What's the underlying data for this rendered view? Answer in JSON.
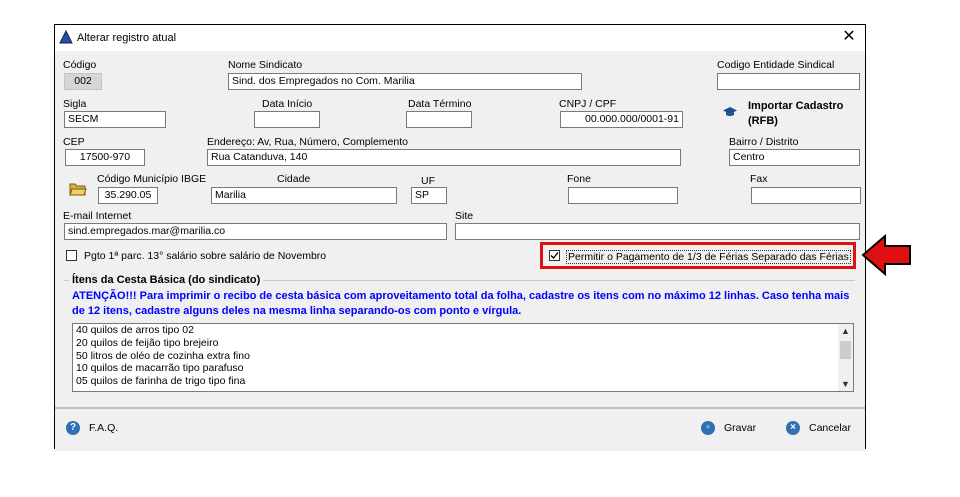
{
  "window": {
    "title": "Alterar registro atual",
    "close": "✕"
  },
  "fields": {
    "codigo": {
      "label": "Código",
      "value": "002"
    },
    "nome_sindicato": {
      "label": "Nome Sindicato",
      "value": "Sind. dos Empregados no Com. Marilia"
    },
    "codigo_entidade": {
      "label": "Codigo Entidade Sindical",
      "value": ""
    },
    "sigla": {
      "label": "Sigla",
      "value": "SECM"
    },
    "data_inicio": {
      "label": "Data Início",
      "value": ""
    },
    "data_termino": {
      "label": "Data Término",
      "value": ""
    },
    "cnpj": {
      "label": "CNPJ /  CPF",
      "value": "00.000.000/0001-91"
    },
    "importar": {
      "label": "Importar Cadastro (RFB)"
    },
    "cep": {
      "label": "CEP",
      "value": "17500-970"
    },
    "endereco": {
      "label": "Endereço: Av, Rua, Número, Complemento",
      "value": "Rua Catanduva, 140"
    },
    "bairro": {
      "label": "Bairro / Distrito",
      "value": "Centro"
    },
    "codigo_municipio": {
      "label": "Código Município IBGE",
      "value": "35.290.05"
    },
    "cidade": {
      "label": "Cidade",
      "value": "Marilia"
    },
    "uf": {
      "label": "UF",
      "value": "SP"
    },
    "fone": {
      "label": "Fone",
      "value": ""
    },
    "fax": {
      "label": "Fax",
      "value": ""
    },
    "email": {
      "label": "E-mail Internet",
      "value": "sind.empregados.mar@marilia.co"
    },
    "site": {
      "label": "Site",
      "value": ""
    }
  },
  "checkboxes": {
    "pgto13": {
      "label": "Pgto 1ª parc. 13° salário sobre salário de Novembro",
      "checked": false
    },
    "ferias": {
      "label": "Permitir o Pagamento de 1/3 de Férias Separado das Férias",
      "checked": true
    }
  },
  "cesta": {
    "title": "Ítens da Cesta Básica (do sindicato)",
    "warning": "ATENÇÃO!!! Para imprimir o recibo de cesta básica com aproveitamento total da folha, cadastre os itens com no máximo 12 linhas. Caso tenha mais de 12 itens, cadastre alguns deles na mesma linha separando-os com ponto e vírgula.",
    "items": [
      "40 quilos de arros tipo 02",
      "20 quilos de feijão tipo brejeiro",
      "50 litros de oléo de cozinha extra fino",
      "10 quilos de macarrão tipo parafuso",
      "05 quilos de farinha de trigo tipo fina"
    ]
  },
  "footer": {
    "faq": "F.A.Q.",
    "save": "Gravar",
    "cancel": "Cancelar"
  },
  "colors": {
    "highlight": "#e01010",
    "warning_text": "#0000ff",
    "icon_blue": "#2f6fb5"
  },
  "icons": {
    "title": "triangle-icon",
    "import": "graduation-cap-icon",
    "folder": "folder-icon",
    "help": "question-icon",
    "save": "disk-icon",
    "cancel": "x-circle-icon",
    "arrow": "red-arrow-icon"
  }
}
